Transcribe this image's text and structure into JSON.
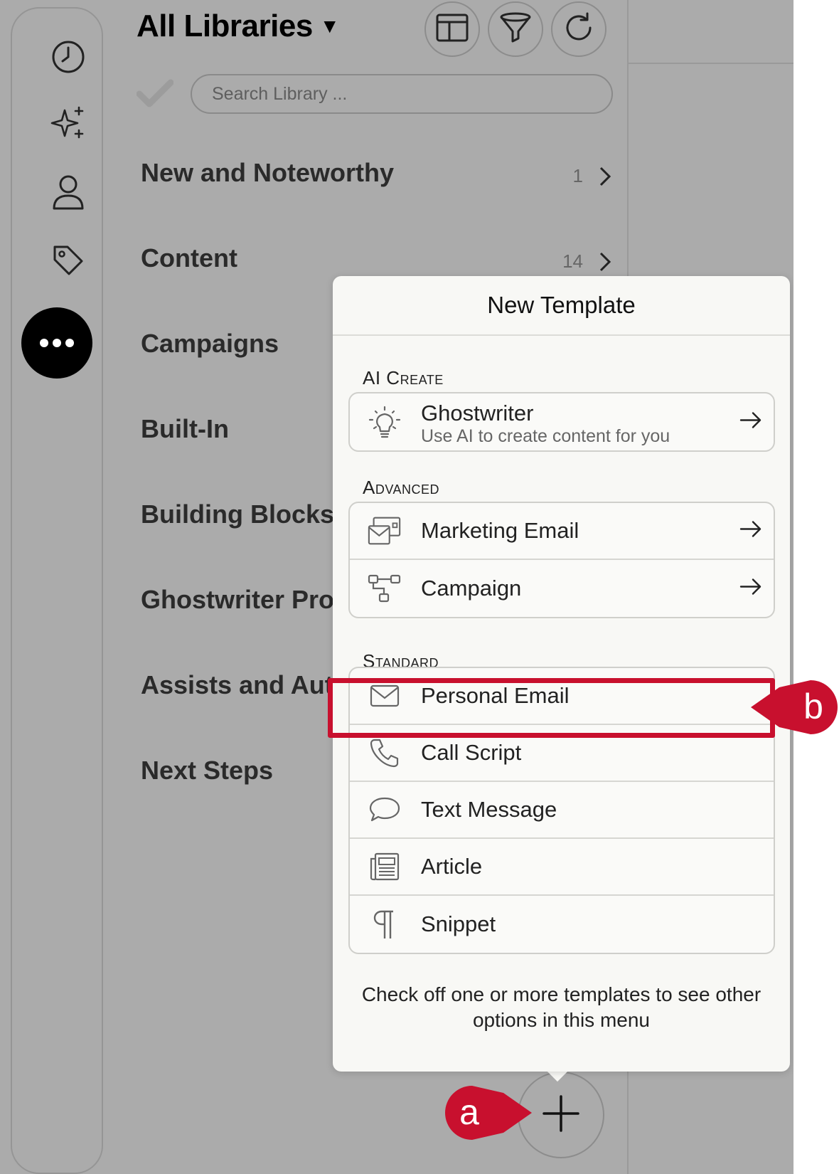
{
  "header": {
    "title": "All Libraries",
    "title_caret": "▼"
  },
  "search": {
    "placeholder": "Search Library ..."
  },
  "libraries": [
    {
      "label": "New and Noteworthy",
      "count": "1"
    },
    {
      "label": "Content",
      "count": "14"
    },
    {
      "label": "Campaigns"
    },
    {
      "label": "Built-In"
    },
    {
      "label": "Building Blocks"
    },
    {
      "label": "Ghostwriter Pro"
    },
    {
      "label": "Assists and Aut"
    },
    {
      "label": "Next Steps"
    }
  ],
  "popover": {
    "title": "New Template",
    "sections": {
      "ai_create": "AI Create",
      "advanced": "Advanced",
      "standard": "Standard"
    },
    "ghostwriter": {
      "label": "Ghostwriter",
      "sub": "Use AI to create content for you"
    },
    "advanced_items": [
      {
        "label": "Marketing Email"
      },
      {
        "label": "Campaign"
      }
    ],
    "standard_items": [
      {
        "label": "Personal Email"
      },
      {
        "label": "Call Script"
      },
      {
        "label": "Text Message"
      },
      {
        "label": "Article"
      },
      {
        "label": "Snippet"
      }
    ],
    "footer": "Check off one or more templates to see other options in this menu"
  },
  "callouts": {
    "a": "a",
    "b": "b"
  },
  "colors": {
    "highlight": "#c8102e",
    "background": "#ababab",
    "popover": "#f8f8f5"
  },
  "icons": {
    "rail": [
      "clock-icon",
      "sparkles-icon",
      "person-icon",
      "tag-icon",
      "more-icon"
    ],
    "toolbar": [
      "layout-icon",
      "filter-icon",
      "refresh-icon"
    ]
  }
}
